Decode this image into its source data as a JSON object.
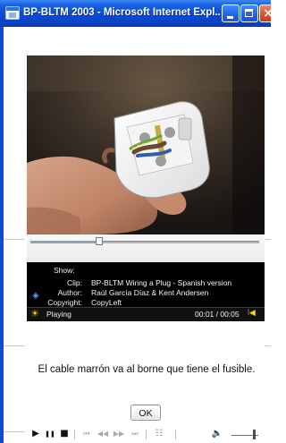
{
  "window": {
    "title": "BP-BLTM 2003 - Microsoft Internet Expl..."
  },
  "player": {
    "controls": {
      "play_icon": "▶",
      "pause_icon": "❚❚",
      "stop_icon": "■",
      "prev_icon": "⏮",
      "rewind_icon": "◀◀",
      "forward_icon": "▶▶",
      "next_icon": "⏭",
      "menu_icon": "☷",
      "volume_icon": "🔈"
    },
    "seek_progress": 0.3,
    "volume_level": 0.85,
    "info": {
      "show_label": "Show:",
      "clip_label": "Clip:",
      "clip_value": "BP-BLTM Wiring a Plug - Spanish version",
      "author_label": "Author:",
      "author_value": "Raúl García Díaz & Kent Andersen",
      "copyright_label": "Copyright:",
      "copyright_value": "CopyLeft"
    },
    "status": {
      "icon": "sun-icon",
      "state": "Playing",
      "time": "00:01 / 00:05"
    }
  },
  "dialog": {
    "message": "El cable marrón va al borne que tiene el fusible.",
    "ok_label": "OK"
  },
  "colors": {
    "titlebar": "#0b4bd5",
    "player_bg": "#000000",
    "status_accent": "#ffd200"
  }
}
